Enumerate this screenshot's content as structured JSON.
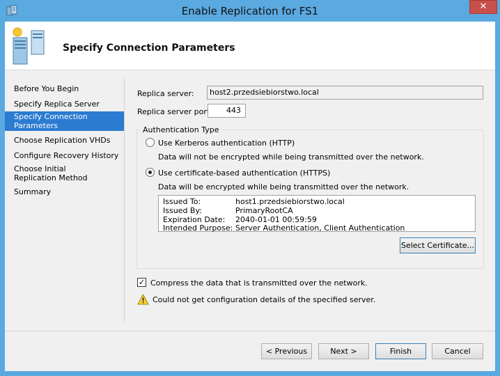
{
  "window": {
    "title": "Enable Replication for FS1",
    "close_glyph": "✕",
    "title_icon": "hyper-v-server-icon",
    "accent_color": "#5aa9e0"
  },
  "header": {
    "title": "Specify Connection Parameters",
    "icon": "replication-wizard-icon"
  },
  "nav": {
    "items": [
      {
        "label": "Before You Begin"
      },
      {
        "label": "Specify Replica Server"
      },
      {
        "label": "Specify Connection Parameters",
        "active": true
      },
      {
        "label": "Choose Replication VHDs"
      },
      {
        "label": "Configure Recovery History"
      },
      {
        "label": "Choose Initial Replication Method"
      },
      {
        "label": "Summary"
      }
    ]
  },
  "form": {
    "replica_server_label": "Replica server:",
    "replica_server_value": "host2.przedsiebiorstwo.local",
    "replica_port_label": "Replica server port:",
    "replica_port_value": "443",
    "auth_group_label": "Authentication Type",
    "kerberos_label": "Use Kerberos authentication (HTTP)",
    "kerberos_desc": "Data will not be encrypted while being transmitted over the network.",
    "kerberos_selected": false,
    "cert_label": "Use certificate-based authentication (HTTPS)",
    "cert_desc": "Data will be encrypted while being transmitted over the network.",
    "cert_selected": true,
    "certificate": {
      "issued_to_label": "Issued To:",
      "issued_to": "host1.przedsiebiorstwo.local",
      "issued_by_label": "Issued By:",
      "issued_by": "PrimaryRootCA",
      "expiration_label": "Expiration Date:",
      "expiration": "2040-01-01 00:59:59",
      "purpose_label": "Intended Purpose:",
      "purpose": "Server Authentication, Client Authentication"
    },
    "select_cert_button": "Select Certificate...",
    "compress_label": "Compress the data that is transmitted over the network.",
    "compress_checked": true,
    "check_glyph": "✓",
    "warning_text": "Could not get configuration details of the specified server.",
    "warning_icon": "warning-icon"
  },
  "footer": {
    "previous_button": "< Previous",
    "next_button": "Next >",
    "finish_button": "Finish",
    "cancel_button": "Cancel"
  }
}
